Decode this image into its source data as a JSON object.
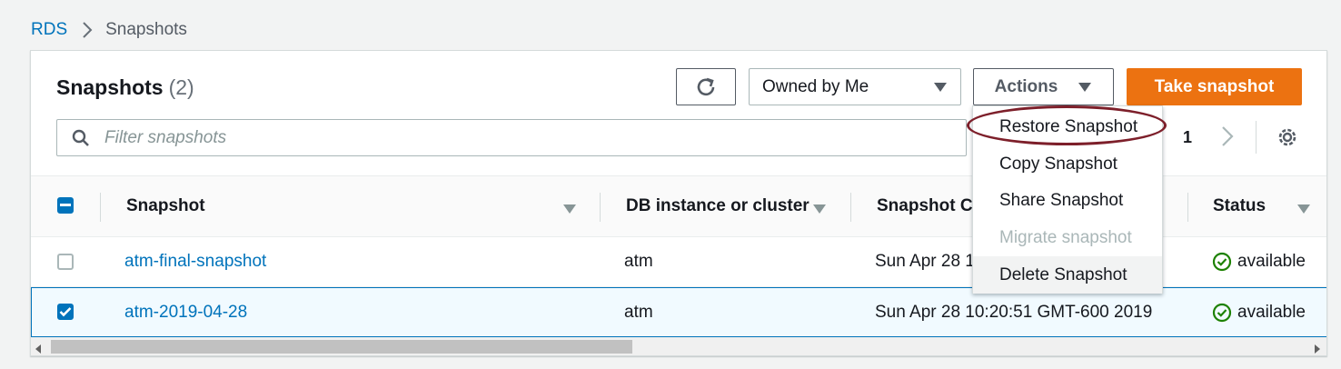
{
  "breadcrumb": {
    "root": "RDS",
    "current": "Snapshots"
  },
  "panel": {
    "title": "Snapshots",
    "count": "(2)",
    "owned_select": "Owned by Me",
    "actions_label": "Actions",
    "take_label": "Take snapshot",
    "search_placeholder": "Filter snapshots",
    "page_number": "1"
  },
  "table": {
    "columns": [
      "Snapshot",
      "DB instance or cluster",
      "Snapshot Cr",
      "Status"
    ],
    "rows": [
      {
        "snapshot": "atm-final-snapshot",
        "instance": "atm",
        "created": "Sun Apr 28 1",
        "status": "available",
        "checked": false
      },
      {
        "snapshot": "atm-2019-04-28",
        "instance": "atm",
        "created": "Sun Apr 28 10:20:51 GMT-600 2019",
        "status": "available",
        "checked": true
      }
    ]
  },
  "actions_menu": {
    "items": [
      "Restore Snapshot",
      "Copy Snapshot",
      "Share Snapshot",
      "Migrate snapshot",
      "Delete Snapshot"
    ]
  },
  "colors": {
    "accent": "#0073bb",
    "primary_button": "#ec7211",
    "status_ok": "#1d8102",
    "highlight": "#7d1f2a"
  },
  "icons": [
    "chevron-right-icon",
    "refresh-icon",
    "caret-down-icon",
    "search-icon",
    "settings-icon",
    "check-circle-icon",
    "checkbox-icon"
  ]
}
